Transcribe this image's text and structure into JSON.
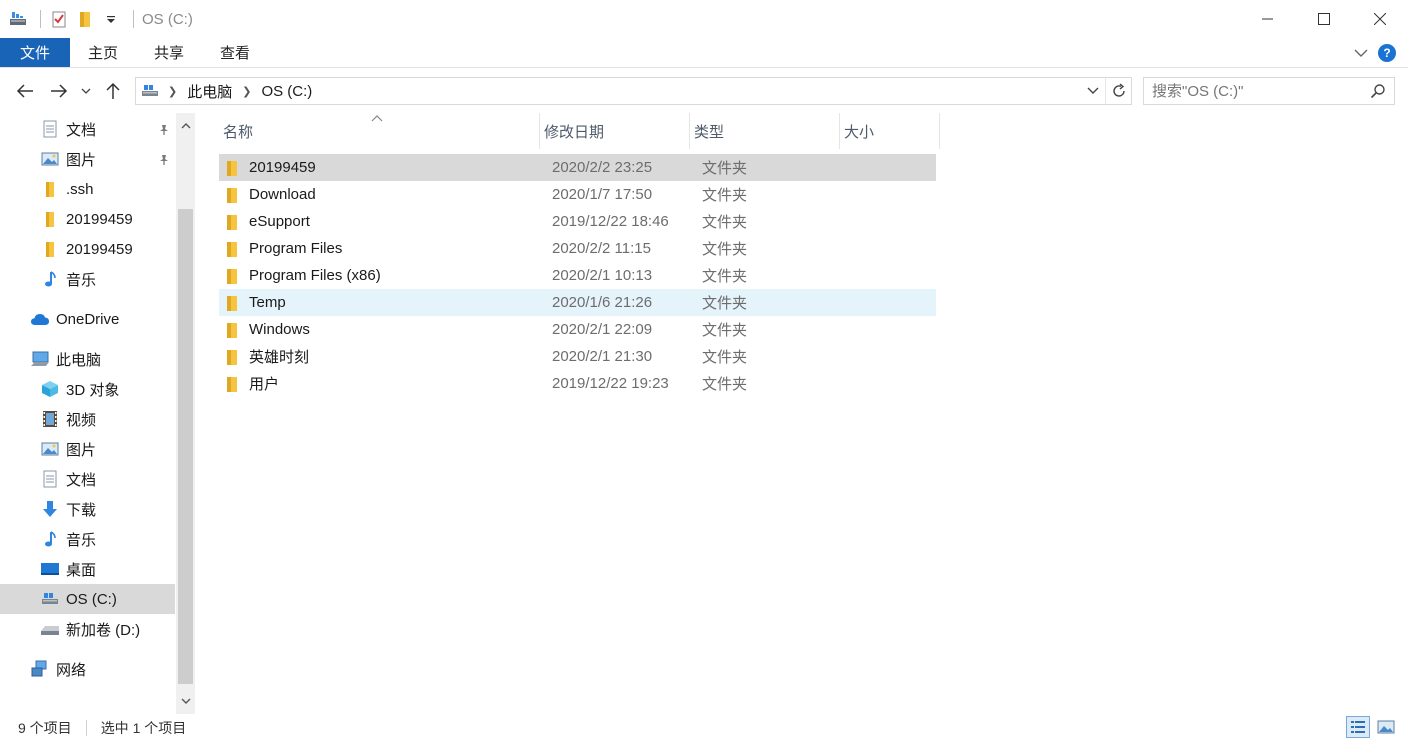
{
  "window": {
    "title": "OS (C:)",
    "minimize_glyph": "—",
    "maximize_glyph": "☐",
    "close_glyph": "✕"
  },
  "ribbon": {
    "tabs": [
      {
        "label": "文件"
      },
      {
        "label": "主页"
      },
      {
        "label": "共享"
      },
      {
        "label": "查看"
      }
    ],
    "help_glyph": "?"
  },
  "address": {
    "crumbs": [
      "此电脑",
      "OS (C:)"
    ]
  },
  "search": {
    "placeholder": "搜索\"OS (C:)\""
  },
  "navpane": {
    "items": [
      {
        "label": "文档",
        "icon": "documents-icon",
        "pinned": true
      },
      {
        "label": "图片",
        "icon": "pictures-icon",
        "pinned": true
      },
      {
        "label": ".ssh",
        "icon": "folder-icon"
      },
      {
        "label": "20199459",
        "icon": "folder-icon"
      },
      {
        "label": "20199459",
        "icon": "folder-icon"
      },
      {
        "label": "音乐",
        "icon": "music-icon"
      },
      {
        "label": "OneDrive",
        "icon": "onedrive-icon"
      },
      {
        "label": "此电脑",
        "icon": "this-pc-icon"
      },
      {
        "label": "3D 对象",
        "icon": "3d-objects-icon"
      },
      {
        "label": "视频",
        "icon": "videos-icon"
      },
      {
        "label": "图片",
        "icon": "pictures-icon"
      },
      {
        "label": "文档",
        "icon": "documents-icon"
      },
      {
        "label": "下载",
        "icon": "downloads-icon"
      },
      {
        "label": "音乐",
        "icon": "music-icon"
      },
      {
        "label": "桌面",
        "icon": "desktop-icon"
      },
      {
        "label": "OS (C:)",
        "icon": "os-drive-icon"
      },
      {
        "label": "新加卷 (D:)",
        "icon": "drive-icon"
      },
      {
        "label": "网络",
        "icon": "network-icon"
      }
    ]
  },
  "list": {
    "columns": {
      "name": "名称",
      "date": "修改日期",
      "type": "类型",
      "size": "大小"
    },
    "rows": [
      {
        "name": "20199459",
        "date": "2020/2/2 23:25",
        "type": "文件夹"
      },
      {
        "name": "Download",
        "date": "2020/1/7 17:50",
        "type": "文件夹"
      },
      {
        "name": "eSupport",
        "date": "2019/12/22 18:46",
        "type": "文件夹"
      },
      {
        "name": "Program Files",
        "date": "2020/2/2 11:15",
        "type": "文件夹"
      },
      {
        "name": "Program Files (x86)",
        "date": "2020/2/1 10:13",
        "type": "文件夹"
      },
      {
        "name": "Temp",
        "date": "2020/1/6 21:26",
        "type": "文件夹"
      },
      {
        "name": "Windows",
        "date": "2020/2/1 22:09",
        "type": "文件夹"
      },
      {
        "name": "英雄时刻",
        "date": "2020/2/1 21:30",
        "type": "文件夹"
      },
      {
        "name": "用户",
        "date": "2019/12/22 19:23",
        "type": "文件夹"
      }
    ]
  },
  "status": {
    "count": "9 个项目",
    "selected": "选中 1 个项目"
  },
  "colors": {
    "accent": "#1a64b8",
    "selected_row": "#d9d9d9",
    "hover_row": "#e5f3fb",
    "folder": "#f5c542"
  }
}
